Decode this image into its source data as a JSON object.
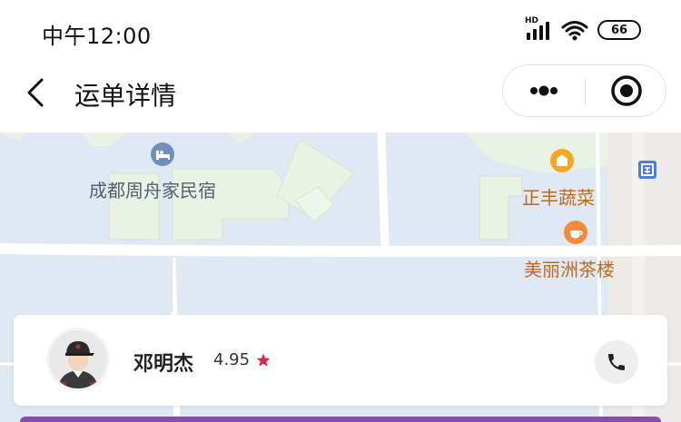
{
  "status_bar": {
    "time": "中午12:00",
    "signal_badge": "HD",
    "battery": "66",
    "icons": [
      "signal-icon",
      "wifi-icon",
      "battery-icon"
    ]
  },
  "nav": {
    "title": "运单详情",
    "back_icon": "chevron-left-icon",
    "capsule_icons": [
      "more-dots-icon",
      "target-close-icon"
    ]
  },
  "map": {
    "pois": [
      {
        "name": "成都周舟家民宿",
        "icon": "hotel-icon",
        "color": "#556072"
      },
      {
        "name": "正丰蔬菜",
        "icon": "shop-icon",
        "color": "#c06a19"
      },
      {
        "name": "美丽洲茶楼",
        "icon": "tea-icon",
        "color": "#c06a19"
      }
    ],
    "colors": {
      "water": "#dfe8f3",
      "block": "#e9f2e4",
      "road": "#ffffff",
      "poi_orange": "#f5a623"
    }
  },
  "driver": {
    "name": "邓明杰",
    "rating": "4.95",
    "rating_icon": "star-icon",
    "star_color": "#d9263c",
    "call_icon": "phone-icon"
  },
  "accent_color": "#8a4bb0"
}
